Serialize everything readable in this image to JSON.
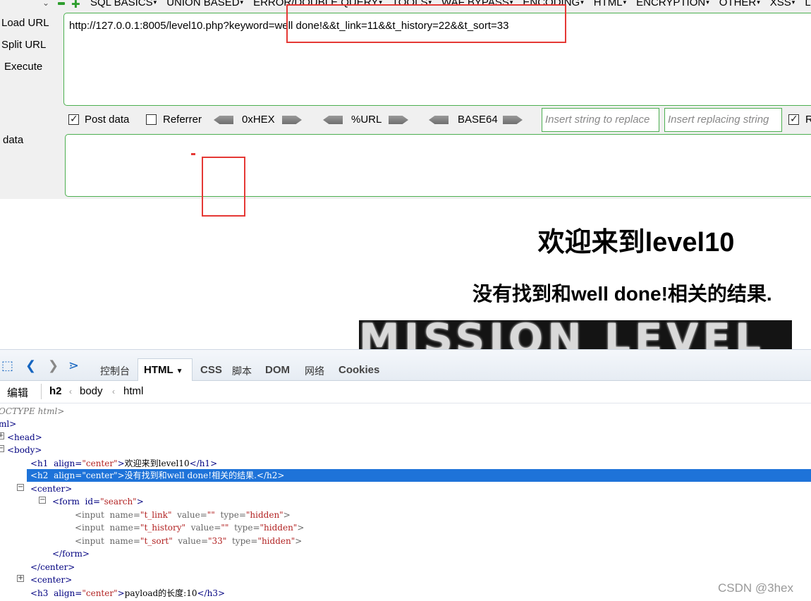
{
  "hackbar": {
    "menu": [
      "SQL BASICS",
      "UNION BASED",
      "ERROR/DOUBLE QUERY",
      "TOOLS",
      "WAF BYPASS",
      "ENCODING",
      "HTML",
      "ENCRYPTION",
      "OTHER",
      "XSS",
      "LFI"
    ],
    "load_url": "Load URL",
    "split_url": "Split URL",
    "execute": "Execute",
    "url": "http://127.0.0.1:8005/level10.php?keyword=well done!&&t_link=11&&t_history=22&&t_sort=33",
    "post_data_label": "Post data",
    "post_data_checked": true,
    "referrer_label": "Referrer",
    "referrer_checked": false,
    "hex_label": "0xHEX",
    "url_label": "%URL",
    "base64_label": "BASE64",
    "replace_placeholder": "Insert string to replace",
    "replacing_placeholder": "Insert replacing string",
    "last_check_label": "R",
    "post_label": "data",
    "post_value": ""
  },
  "page": {
    "h1": "欢迎来到level10",
    "h2": "没有找到和well done!相关的结果.",
    "image_text": "Mission Level"
  },
  "devtools": {
    "tabs": [
      "控制台",
      "HTML",
      "CSS",
      "脚本",
      "DOM",
      "网络",
      "Cookies"
    ],
    "active_tab": "HTML",
    "edit_label": "编辑",
    "breadcrumb": [
      "h2",
      "body",
      "html"
    ],
    "tree": {
      "doctype": "OCTYPE html>",
      "html_open": "ml>",
      "head": "<head>",
      "body": "<body>",
      "h1_open": "<h1",
      "h1_attr": "align=",
      "h1_val": "\"center\"",
      "h1_text": "欢迎来到level10",
      "h1_close": "</h1>",
      "h2_open": "<h2",
      "h2_attr": "align=",
      "h2_val": "\"center\"",
      "h2_text": "没有找到和well done!相关的结果.",
      "h2_close": "</h2>",
      "center_open": "<center>",
      "form_open": "<form",
      "form_attr": "id=",
      "form_val": "\"search\"",
      "input1": {
        "name": "\"t_link\"",
        "value": "\"\"",
        "type": "\"hidden\""
      },
      "input2": {
        "name": "\"t_history\"",
        "value": "\"\"",
        "type": "\"hidden\""
      },
      "input3": {
        "name": "\"t_sort\"",
        "value": "\"33\"",
        "type": "\"hidden\""
      },
      "input_tag": "<input",
      "name_attr": "name=",
      "value_attr": "value=",
      "type_attr": "type=",
      "tag_end": ">",
      "form_close": "</form>",
      "center_close": "</center>",
      "center2_open": "<center>",
      "h3_open": "<h3",
      "h3_attr": "align=",
      "h3_val": "\"center\"",
      "h3_text": "payload的长度:10",
      "h3_close": "</h3>",
      "gt": ">"
    }
  },
  "watermark": "CSDN @3hex",
  "colors": {
    "accent_green": "#4caf50",
    "highlight_red": "#e53935",
    "selection_blue": "#1e73d9"
  }
}
